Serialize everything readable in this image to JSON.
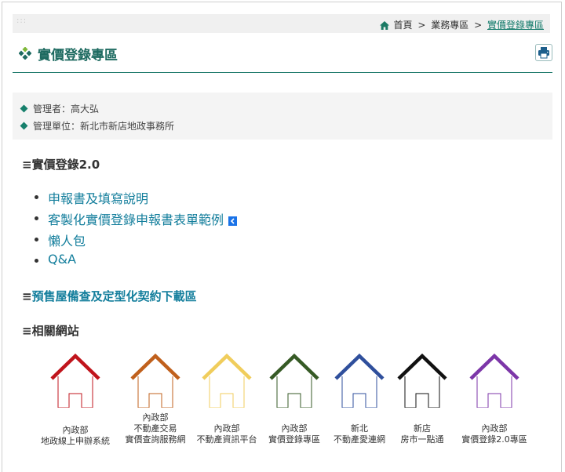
{
  "breadcrumb": {
    "dots": ":::",
    "items": [
      "首頁",
      "業務專區",
      "實價登錄專區"
    ],
    "separator": ">"
  },
  "page": {
    "title": "實價登錄專區",
    "print_label": "列印"
  },
  "info": {
    "manager": "管理者：高大弘",
    "unit": "管理單位：新北市新店地政事務所"
  },
  "sections": {
    "bars": "≡",
    "realprice": "實價登錄2.0",
    "presale": "預售屋備查及定型化契約下載區",
    "related": "相關網站"
  },
  "links": [
    "申報書及填寫說明",
    "客製化實價登錄申報書表單範例",
    "懶人包",
    "Q&A"
  ],
  "sites": [
    {
      "label": "內政部\n地政線上申辦系統",
      "color": "#c0141c",
      "icon": "house-icon"
    },
    {
      "label": "內政部\n不動產交易\n實價查詢服務網",
      "color": "#c0601c",
      "icon": "house-icon"
    },
    {
      "label": "內政部\n不動產資訊平台",
      "color": "#f0cd5c",
      "icon": "house-icon"
    },
    {
      "label": "內政部\n實價登錄專區",
      "color": "#365a25",
      "icon": "house-icon"
    },
    {
      "label": "新北\n不動產愛連網",
      "color": "#2f4f9c",
      "icon": "house-icon"
    },
    {
      "label": "新店\n房市一點通",
      "color": "#111111",
      "icon": "house-icon"
    },
    {
      "label": "內政部\n實價登錄2.0專區",
      "color": "#7c36a8",
      "icon": "house-icon"
    }
  ],
  "colors": {
    "accent": "#1d6a60",
    "link": "#137e9c"
  }
}
